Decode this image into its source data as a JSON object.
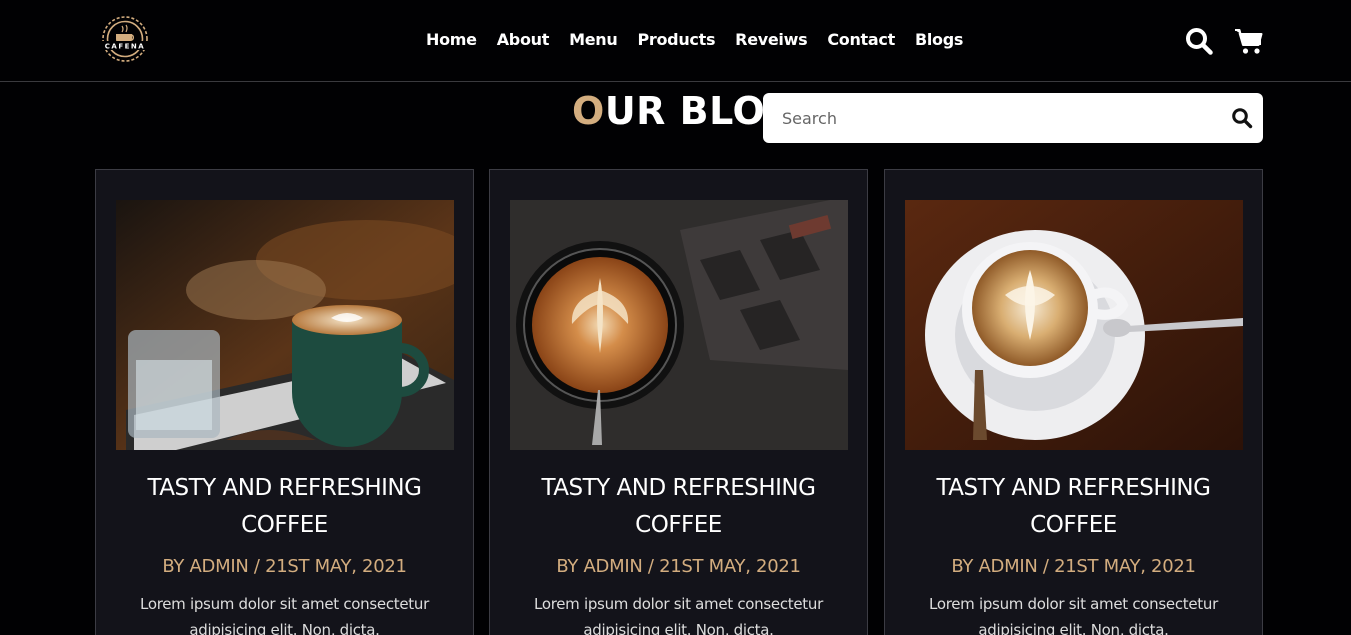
{
  "brand": {
    "logo_text": "CAFENA"
  },
  "nav": {
    "items": [
      {
        "label": "Home"
      },
      {
        "label": "About"
      },
      {
        "label": "Menu"
      },
      {
        "label": "Products"
      },
      {
        "label": "Reveiws"
      },
      {
        "label": "Contact"
      },
      {
        "label": "Blogs"
      }
    ]
  },
  "header_icons": {
    "search": "search-icon",
    "cart": "cart-icon"
  },
  "blog": {
    "title_first": "O",
    "title_rest": "UR BLOG",
    "search_placeholder": "Search",
    "cards": [
      {
        "title": "TASTY AND REFRESHING COFFEE",
        "meta": "BY ADMIN / 21ST MAY, 2021",
        "excerpt": "Lorem ipsum dolor sit amet consectetur adipisicing elit. Non, dicta."
      },
      {
        "title": "TASTY AND REFRESHING COFFEE",
        "meta": "BY ADMIN / 21ST MAY, 2021",
        "excerpt": "Lorem ipsum dolor sit amet consectetur adipisicing elit. Non, dicta."
      },
      {
        "title": "TASTY AND REFRESHING COFFEE",
        "meta": "BY ADMIN / 21ST MAY, 2021",
        "excerpt": "Lorem ipsum dolor sit amet consectetur adipisicing elit. Non, dicta."
      }
    ]
  },
  "colors": {
    "accent": "#d3ad7f",
    "background": "#010103",
    "card": "#13131a"
  }
}
